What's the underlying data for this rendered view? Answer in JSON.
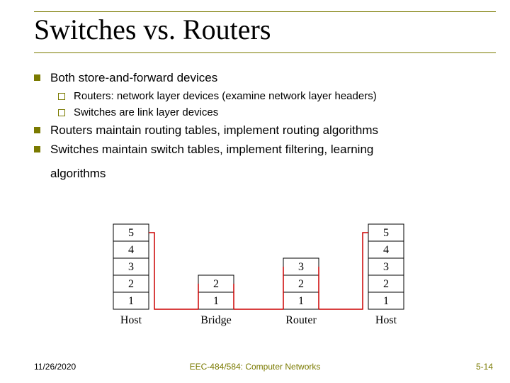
{
  "title": "Switches vs. Routers",
  "bullets": {
    "b1": {
      "text": "Both store-and-forward devices",
      "sub": [
        "Routers: network layer devices (examine network layer headers)",
        "Switches are link layer devices"
      ]
    },
    "b2": {
      "text": "Routers maintain routing tables, implement routing algorithms"
    },
    "b3": {
      "text": "Switches maintain switch tables, implement filtering, learning"
    }
  },
  "continuation": "algorithms",
  "diagram": {
    "labels": [
      "Host",
      "Bridge",
      "Router",
      "Host"
    ],
    "stacks": {
      "host_left": [
        "1",
        "2",
        "3",
        "4",
        "5"
      ],
      "bridge": [
        "1",
        "2"
      ],
      "router": [
        "1",
        "2",
        "3"
      ],
      "host_right": [
        "1",
        "2",
        "3",
        "4",
        "5"
      ]
    }
  },
  "footer": {
    "date": "11/26/2020",
    "course": "EEC-484/584: Computer Networks",
    "page": "5-14"
  }
}
